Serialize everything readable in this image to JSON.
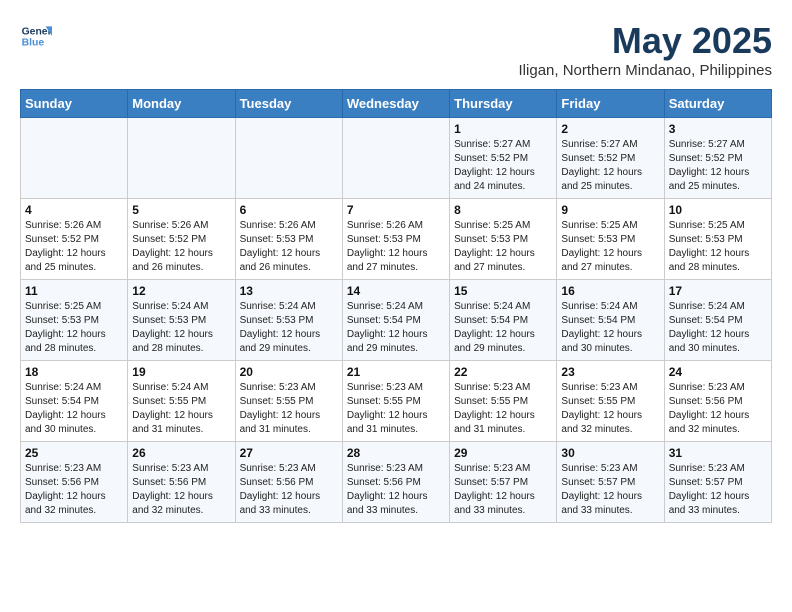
{
  "header": {
    "logo_line1": "General",
    "logo_line2": "Blue",
    "month_title": "May 2025",
    "location": "Iligan, Northern Mindanao, Philippines"
  },
  "weekdays": [
    "Sunday",
    "Monday",
    "Tuesday",
    "Wednesday",
    "Thursday",
    "Friday",
    "Saturday"
  ],
  "weeks": [
    [
      {
        "day": "",
        "info": ""
      },
      {
        "day": "",
        "info": ""
      },
      {
        "day": "",
        "info": ""
      },
      {
        "day": "",
        "info": ""
      },
      {
        "day": "1",
        "info": "Sunrise: 5:27 AM\nSunset: 5:52 PM\nDaylight: 12 hours\nand 24 minutes."
      },
      {
        "day": "2",
        "info": "Sunrise: 5:27 AM\nSunset: 5:52 PM\nDaylight: 12 hours\nand 25 minutes."
      },
      {
        "day": "3",
        "info": "Sunrise: 5:27 AM\nSunset: 5:52 PM\nDaylight: 12 hours\nand 25 minutes."
      }
    ],
    [
      {
        "day": "4",
        "info": "Sunrise: 5:26 AM\nSunset: 5:52 PM\nDaylight: 12 hours\nand 25 minutes."
      },
      {
        "day": "5",
        "info": "Sunrise: 5:26 AM\nSunset: 5:52 PM\nDaylight: 12 hours\nand 26 minutes."
      },
      {
        "day": "6",
        "info": "Sunrise: 5:26 AM\nSunset: 5:53 PM\nDaylight: 12 hours\nand 26 minutes."
      },
      {
        "day": "7",
        "info": "Sunrise: 5:26 AM\nSunset: 5:53 PM\nDaylight: 12 hours\nand 27 minutes."
      },
      {
        "day": "8",
        "info": "Sunrise: 5:25 AM\nSunset: 5:53 PM\nDaylight: 12 hours\nand 27 minutes."
      },
      {
        "day": "9",
        "info": "Sunrise: 5:25 AM\nSunset: 5:53 PM\nDaylight: 12 hours\nand 27 minutes."
      },
      {
        "day": "10",
        "info": "Sunrise: 5:25 AM\nSunset: 5:53 PM\nDaylight: 12 hours\nand 28 minutes."
      }
    ],
    [
      {
        "day": "11",
        "info": "Sunrise: 5:25 AM\nSunset: 5:53 PM\nDaylight: 12 hours\nand 28 minutes."
      },
      {
        "day": "12",
        "info": "Sunrise: 5:24 AM\nSunset: 5:53 PM\nDaylight: 12 hours\nand 28 minutes."
      },
      {
        "day": "13",
        "info": "Sunrise: 5:24 AM\nSunset: 5:53 PM\nDaylight: 12 hours\nand 29 minutes."
      },
      {
        "day": "14",
        "info": "Sunrise: 5:24 AM\nSunset: 5:54 PM\nDaylight: 12 hours\nand 29 minutes."
      },
      {
        "day": "15",
        "info": "Sunrise: 5:24 AM\nSunset: 5:54 PM\nDaylight: 12 hours\nand 29 minutes."
      },
      {
        "day": "16",
        "info": "Sunrise: 5:24 AM\nSunset: 5:54 PM\nDaylight: 12 hours\nand 30 minutes."
      },
      {
        "day": "17",
        "info": "Sunrise: 5:24 AM\nSunset: 5:54 PM\nDaylight: 12 hours\nand 30 minutes."
      }
    ],
    [
      {
        "day": "18",
        "info": "Sunrise: 5:24 AM\nSunset: 5:54 PM\nDaylight: 12 hours\nand 30 minutes."
      },
      {
        "day": "19",
        "info": "Sunrise: 5:24 AM\nSunset: 5:55 PM\nDaylight: 12 hours\nand 31 minutes."
      },
      {
        "day": "20",
        "info": "Sunrise: 5:23 AM\nSunset: 5:55 PM\nDaylight: 12 hours\nand 31 minutes."
      },
      {
        "day": "21",
        "info": "Sunrise: 5:23 AM\nSunset: 5:55 PM\nDaylight: 12 hours\nand 31 minutes."
      },
      {
        "day": "22",
        "info": "Sunrise: 5:23 AM\nSunset: 5:55 PM\nDaylight: 12 hours\nand 31 minutes."
      },
      {
        "day": "23",
        "info": "Sunrise: 5:23 AM\nSunset: 5:55 PM\nDaylight: 12 hours\nand 32 minutes."
      },
      {
        "day": "24",
        "info": "Sunrise: 5:23 AM\nSunset: 5:56 PM\nDaylight: 12 hours\nand 32 minutes."
      }
    ],
    [
      {
        "day": "25",
        "info": "Sunrise: 5:23 AM\nSunset: 5:56 PM\nDaylight: 12 hours\nand 32 minutes."
      },
      {
        "day": "26",
        "info": "Sunrise: 5:23 AM\nSunset: 5:56 PM\nDaylight: 12 hours\nand 32 minutes."
      },
      {
        "day": "27",
        "info": "Sunrise: 5:23 AM\nSunset: 5:56 PM\nDaylight: 12 hours\nand 33 minutes."
      },
      {
        "day": "28",
        "info": "Sunrise: 5:23 AM\nSunset: 5:56 PM\nDaylight: 12 hours\nand 33 minutes."
      },
      {
        "day": "29",
        "info": "Sunrise: 5:23 AM\nSunset: 5:57 PM\nDaylight: 12 hours\nand 33 minutes."
      },
      {
        "day": "30",
        "info": "Sunrise: 5:23 AM\nSunset: 5:57 PM\nDaylight: 12 hours\nand 33 minutes."
      },
      {
        "day": "31",
        "info": "Sunrise: 5:23 AM\nSunset: 5:57 PM\nDaylight: 12 hours\nand 33 minutes."
      }
    ]
  ]
}
